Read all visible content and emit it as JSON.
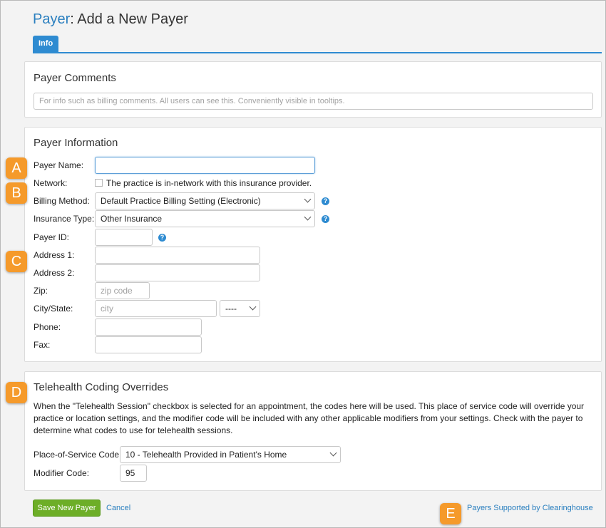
{
  "header": {
    "crumb": "Payer",
    "title": ": Add a New Payer"
  },
  "tabs": [
    {
      "label": "Info"
    }
  ],
  "comments": {
    "heading": "Payer Comments",
    "placeholder": "For info such as billing comments. All users can see this. Conveniently visible in tooltips."
  },
  "info": {
    "heading": "Payer Information",
    "payer_name_label": "Payer Name:",
    "network_label": "Network:",
    "network_text": "The practice is in-network with this insurance provider.",
    "billing_method_label": "Billing Method:",
    "billing_method_value": "Default Practice Billing Setting (Electronic)",
    "insurance_type_label": "Insurance Type:",
    "insurance_type_value": "Other Insurance",
    "payer_id_label": "Payer ID:",
    "address1_label": "Address 1:",
    "address2_label": "Address 2:",
    "zip_label": "Zip:",
    "zip_placeholder": "zip code",
    "city_label": "City/State:",
    "city_placeholder": "city",
    "state_value": "----",
    "phone_label": "Phone:",
    "fax_label": "Fax:"
  },
  "telehealth": {
    "heading": "Telehealth Coding Overrides",
    "description": "When the \"Telehealth Session\" checkbox is selected for an appointment, the codes here will be used. This place of service code will override your practice or location settings, and the modifier code will be included with any other applicable modifiers from your settings. Check with the payer to determine what codes to use for telehealth sessions.",
    "pos_label": "Place-of-Service Code:",
    "pos_value": "10 - Telehealth Provided in Patient's Home",
    "modifier_label": "Modifier Code:",
    "modifier_value": "95"
  },
  "footer": {
    "save_label": "Save New Payer",
    "cancel_label": "Cancel",
    "clearinghouse_label": "Payers Supported by Clearinghouse"
  },
  "help_glyph": "?",
  "badges": [
    "A",
    "B",
    "C",
    "D",
    "E"
  ],
  "colors": {
    "accent": "#2e8bd1",
    "save": "#6dae27",
    "badge": "#f59a2b"
  }
}
